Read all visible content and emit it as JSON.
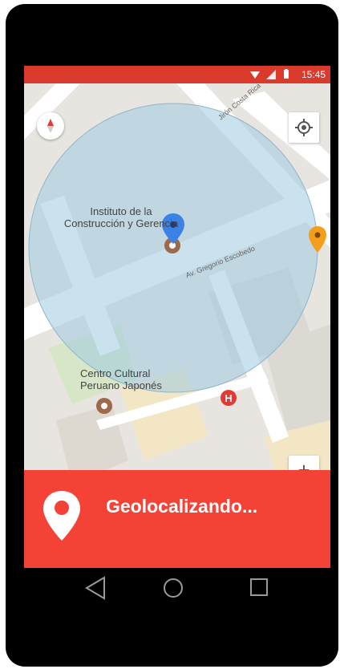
{
  "status_bar": {
    "time": "15:45"
  },
  "map": {
    "places": {
      "institute": "Instituto de la\nConstrucción y Gerencia",
      "cultural_center": "Centro Cultural\nPeruano Japonés"
    },
    "streets": {
      "jiron": "Jirón Costa Rica",
      "avenue": "Av. Gregorio Escobedo"
    },
    "zoom_label": "+"
  },
  "banner": {
    "message": "Geolocalizando..."
  },
  "colors": {
    "status": "#d93a2b",
    "banner": "#f44336",
    "accuracy_circle": "#9fcbe0"
  }
}
